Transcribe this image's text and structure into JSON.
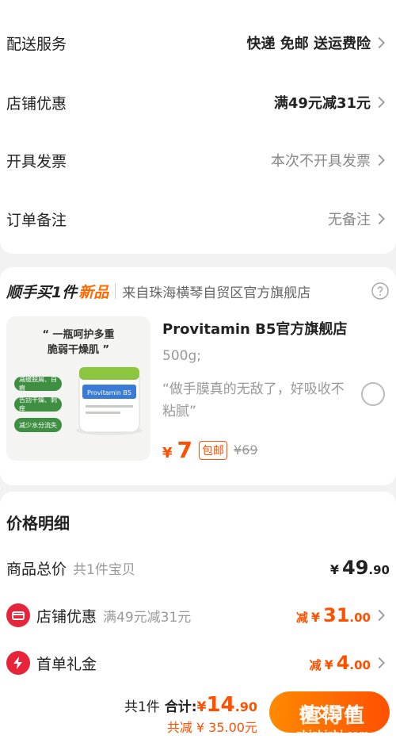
{
  "order_rows": [
    {
      "label": "配送服务",
      "value": "快递 免邮 送运费险"
    },
    {
      "label": "店铺优惠",
      "value": "满49元减31元"
    },
    {
      "label": "开具发票",
      "value": "本次不开具发票"
    },
    {
      "label": "订单备注",
      "value": "无备注"
    }
  ],
  "recommend": {
    "title": "顺手买1件",
    "title_highlight": "新品",
    "source": "来自珠海横琴自贸区官方旗舰店",
    "image_quote": [
      "“ 一瓶呵护多重",
      "脆弱干燥肌 ”"
    ],
    "image_pills": [
      "减缓脱屑、白痕",
      "告别干燥、刺痒",
      "减少水分流失"
    ],
    "jar_brand": "Provitamin B5",
    "shop_name": "Provitamin B5官方旗舰店",
    "spec": "500g;",
    "review": "“做手膜真的无敌了，好吸收不粘腻”",
    "currency": "¥",
    "price": "7",
    "tag": "包邮",
    "original_price": "¥69"
  },
  "price_detail": {
    "title": "价格明细",
    "goods": {
      "name": "商品总价",
      "sub": "共1件宝贝",
      "currency": "¥",
      "int": "49",
      "dec": ".90"
    },
    "shop_discount": {
      "name": "店铺优惠",
      "sub": "满49元减31元",
      "prefix": "减",
      "currency": "¥",
      "int": "31",
      "dec": ".00"
    },
    "first_order": {
      "name": "首单礼金",
      "prefix": "减",
      "currency": "¥",
      "int": "4",
      "dec": ".00"
    }
  },
  "bottom": {
    "count": "共1件",
    "total_label": "合计:",
    "currency": "¥",
    "total_int": "14",
    "total_dec": ".90",
    "saved": "共减 ¥ 35.00元",
    "submit": "提交订单",
    "watermark_big": "值得值",
    "watermark_small": "zhizhizhi.com"
  },
  "colors": {
    "accent": "#ff5000",
    "badge_red": "#e8243a",
    "pill_green": "#3f8f43"
  }
}
